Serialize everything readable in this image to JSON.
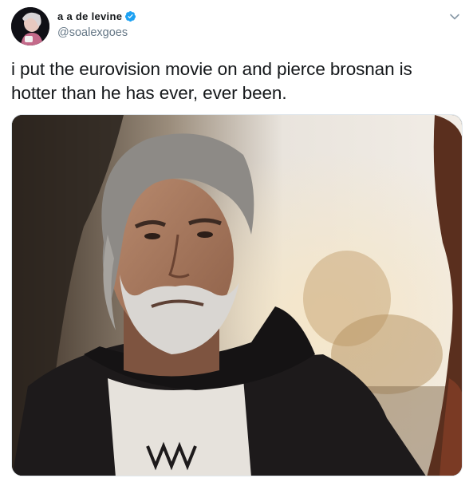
{
  "tweet": {
    "author": {
      "display_name": "a a de levine",
      "handle": "@soalexgoes",
      "verified": true,
      "verified_icon": "verified-badge-icon",
      "avatar_icon": "avatar-image"
    },
    "text": "i put the eurovision movie on and pierce brosnan is hotter than he has ever, ever been.",
    "menu_icon": "chevron-down-icon",
    "media_icon": "photo-image",
    "colors": {
      "verified_blue": "#1da1f2",
      "handle_gray": "#657786",
      "text_black": "#14171a"
    }
  }
}
